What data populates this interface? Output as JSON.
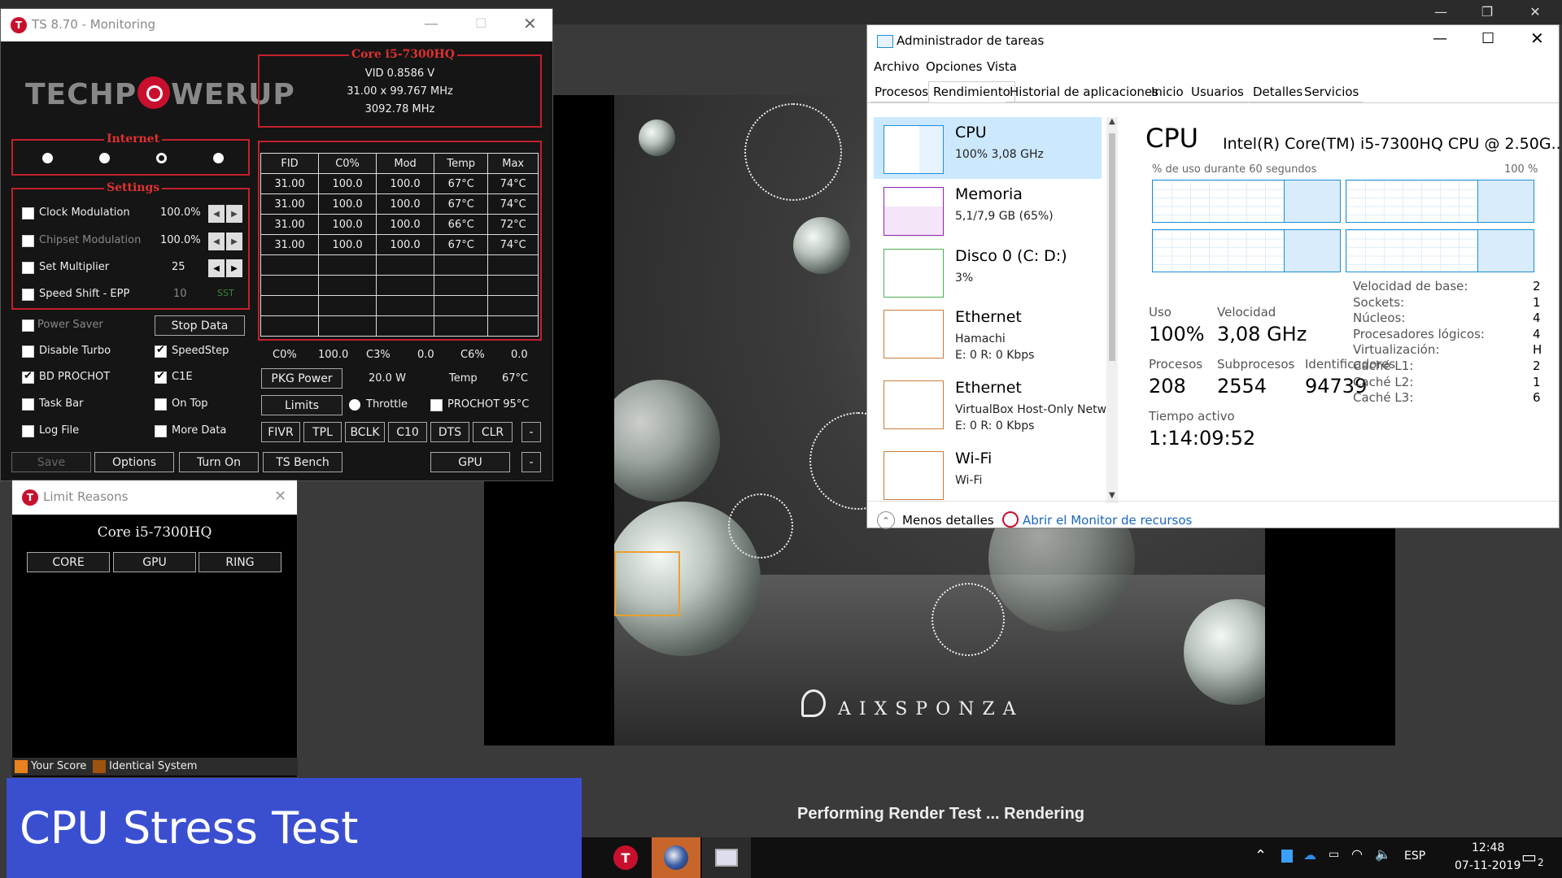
{
  "ts": {
    "title": "TS 8.70 - Monitoring",
    "cpu_name": "Core i5-7300HQ",
    "vid": "VID  0.8586 V",
    "multiplier": "31.00 x 99.767 MHz",
    "frequency": "3092.78 MHz",
    "internet_label": "Internet",
    "settings_label": "Settings",
    "settings": [
      {
        "label": "Clock Modulation",
        "value": "100.0%",
        "checked": false
      },
      {
        "label": "Chipset Modulation",
        "value": "100.0%",
        "checked": false
      },
      {
        "label": "Set Multiplier",
        "value": "25",
        "checked": false
      },
      {
        "label": "Speed Shift - EPP",
        "value": "10",
        "extra": "SST",
        "checked": false
      }
    ],
    "checkboxes": {
      "power_saver": "Power Saver",
      "stop_data": "Stop Data",
      "disable_turbo": "Disable Turbo",
      "speedstep": "SpeedStep",
      "bd_prochot": "BD PROCHOT",
      "c1e": "C1E",
      "task_bar": "Task Bar",
      "on_top": "On Top",
      "log_file": "Log File",
      "more_data": "More Data"
    },
    "table_headers": [
      "FID",
      "C0%",
      "Mod",
      "Temp",
      "Max"
    ],
    "table_rows": [
      [
        "31.00",
        "100.0",
        "100.0",
        "67°C",
        "74°C"
      ],
      [
        "31.00",
        "100.0",
        "100.0",
        "67°C",
        "74°C"
      ],
      [
        "31.00",
        "100.0",
        "100.0",
        "66°C",
        "72°C"
      ],
      [
        "31.00",
        "100.0",
        "100.0",
        "67°C",
        "74°C"
      ],
      [
        "",
        "",
        "",
        "",
        ""
      ],
      [
        "",
        "",
        "",
        "",
        ""
      ],
      [
        "",
        "",
        "",
        "",
        ""
      ],
      [
        "",
        "",
        "",
        "",
        ""
      ]
    ],
    "cstates": {
      "c0": "C0%",
      "c0_val": "100.0",
      "c3": "C3%",
      "c3_val": "0.0",
      "c6": "C6%",
      "c6_val": "0.0"
    },
    "pkg_power": "PKG Power",
    "pkg_power_val": "20.0 W",
    "temp_label": "Temp",
    "temp_val": "67°C",
    "limits": "Limits",
    "throttle": "Throttle",
    "prochot": "PROCHOT 95°C",
    "tool_buttons": [
      "FIVR",
      "TPL",
      "BCLK",
      "C10",
      "DTS",
      "CLR"
    ],
    "minus": "-",
    "bottom_buttons": {
      "save": "Save",
      "options": "Options",
      "turn_on": "Turn On",
      "ts_bench": "TS Bench",
      "gpu": "GPU"
    },
    "logo_left": "TECHP",
    "logo_right": "WERUP"
  },
  "limit_reasons": {
    "title": "Limit Reasons",
    "cpu": "Core i5-7300HQ",
    "buttons": [
      "CORE",
      "GPU",
      "RING"
    ],
    "legend_your": "Your Score",
    "legend_identical": "Identical System"
  },
  "caption": "CPU Stress Test",
  "render": {
    "status": "Performing Render Test ... Rendering",
    "brand": "AIXSPONZA"
  },
  "taskmgr": {
    "title": "Administrador de tareas",
    "menu": [
      "Archivo",
      "Opciones",
      "Vista"
    ],
    "tabs": [
      "Procesos",
      "Rendimiento",
      "Historial de aplicaciones",
      "Inicio",
      "Usuarios",
      "Detalles",
      "Servicios"
    ],
    "resources": [
      {
        "name": "CPU",
        "sub": "100%  3,08 GHz",
        "color": "#1c8fd5"
      },
      {
        "name": "Memoria",
        "sub": "5,1/7,9 GB (65%)",
        "color": "#8e24aa"
      },
      {
        "name": "Disco 0 (C: D:)",
        "sub": "3%",
        "color": "#4caf50"
      },
      {
        "name": "Ethernet",
        "sub": "Hamachi",
        "sub2": "E: 0 R: 0 Kbps",
        "color": "#c87d3c"
      },
      {
        "name": "Ethernet",
        "sub": "VirtualBox Host-Only Netwo",
        "sub2": "E: 0 R: 0 Kbps",
        "color": "#c87d3c"
      },
      {
        "name": "Wi-Fi",
        "sub": "Wi-Fi",
        "color": "#c87d3c"
      }
    ],
    "cpu_title": "CPU",
    "cpu_model": "Intel(R) Core(TM) i5-7300HQ CPU @ 2.50G...",
    "graph_label": "% de uso durante 60 segundos",
    "graph_max": "100 %",
    "uso_label": "Uso",
    "uso": "100%",
    "vel_label": "Velocidad",
    "vel": "3,08 GHz",
    "proc_label": "Procesos",
    "proc": "208",
    "sub_label": "Subprocesos",
    "sub": "2554",
    "ids_label": "Identificadores",
    "ids": "94739",
    "up_label": "Tiempo activo",
    "up": "1:14:09:52",
    "specs": [
      [
        "Velocidad de base:",
        "2"
      ],
      [
        "Sockets:",
        "1"
      ],
      [
        "Núcleos:",
        "4"
      ],
      [
        "Procesadores lógicos:",
        "4"
      ],
      [
        "Virtualización:",
        "H"
      ],
      [
        "Caché L1:",
        "2"
      ],
      [
        "Caché L2:",
        "1"
      ],
      [
        "Caché L3:",
        "6"
      ]
    ],
    "less_details": "Menos detalles",
    "open_monitor": "Abrir el Monitor de recursos"
  },
  "taskbar": {
    "lang": "ESP",
    "time": "12:48",
    "date": "07-11-2019",
    "notif": "2"
  }
}
